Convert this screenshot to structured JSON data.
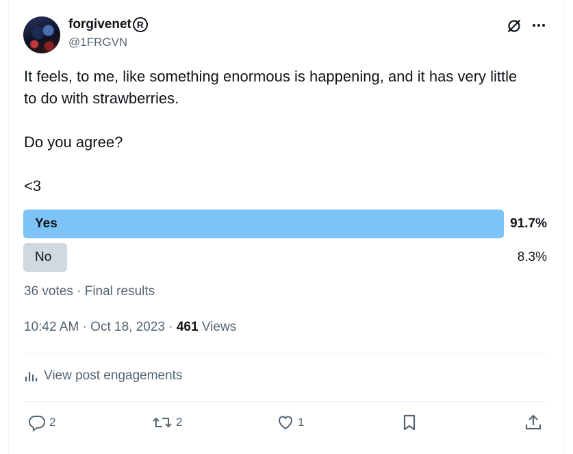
{
  "author": {
    "display_name": "forgivenet",
    "badge": "R",
    "handle": "@1FRGVN"
  },
  "header_icons": [
    "grok-icon",
    "more-icon"
  ],
  "tweet": {
    "text": "It feels, to me, like something enormous is happening, and it has very little to do with strawberries.\n\nDo you agree?\n\n<3"
  },
  "poll": {
    "options": [
      {
        "label": "Yes",
        "percent": "91.7%",
        "value": 0.917,
        "winner": true
      },
      {
        "label": "No",
        "percent": "8.3%",
        "value": 0.083,
        "winner": false
      }
    ],
    "votes": "36 votes",
    "separator": "·",
    "status": "Final results"
  },
  "meta": {
    "time": "10:42 AM",
    "date": "Oct 18, 2023",
    "separator": "·",
    "views_count": "461",
    "views_label": "Views"
  },
  "engagements": {
    "label": "View post engagements"
  },
  "actions": {
    "replies": "2",
    "reposts": "2",
    "likes": "1"
  },
  "colors": {
    "poll_winner": "#7ec3f5",
    "poll_other": "#cfd9de",
    "secondary_text": "#536471",
    "primary_text": "#0f1419"
  }
}
